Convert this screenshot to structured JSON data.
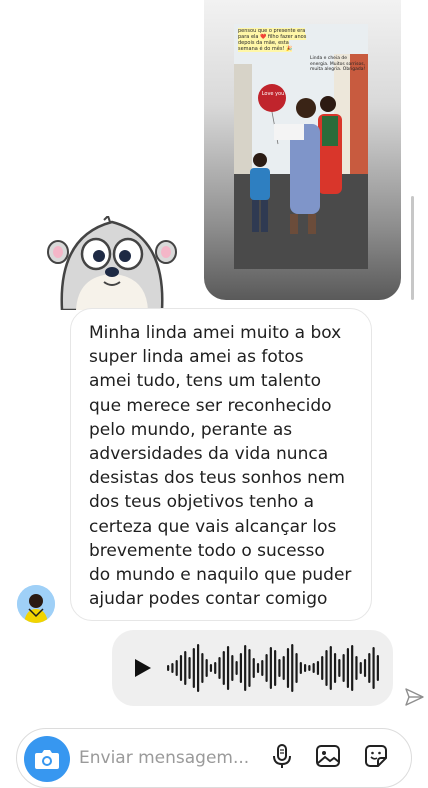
{
  "story": {
    "caption": "pensou que o presente era para ela ❤️ filho fazer anos depois da mãe, esta semana é do mês! 🎉",
    "note": "Linda e cheia de energia. Muitos sorrisos, muita alegria. Obrigada!",
    "balloon_text": "Love you"
  },
  "message": {
    "text": "Minha linda amei muito a box\nsuper linda amei as fotos\namei tudo, tens um talento\nque merece ser reconhecido\npelo mundo, perante as\nadversidades da vida nunca\ndesistas dos teus sonhos nem\ndos teus objetivos tenho a\ncerteza que vais alcançar los\nbrevemente todo o sucesso\ndo mundo e naquilo que puder\najudar podes contar comigo"
  },
  "voice_message": {
    "waveform": [
      6,
      10,
      16,
      26,
      34,
      22,
      40,
      48,
      30,
      18,
      8,
      12,
      22,
      34,
      44,
      26,
      14,
      30,
      46,
      38,
      20,
      10,
      16,
      28,
      42,
      36,
      18,
      24,
      40,
      48,
      30,
      12,
      8,
      6,
      10,
      14,
      24,
      36,
      44,
      30,
      18,
      28,
      40,
      46,
      24,
      12,
      18,
      30,
      42,
      26
    ]
  },
  "composer": {
    "placeholder": "Enviar mensagem..."
  },
  "colors": {
    "accent": "#3797f0",
    "bubble_border": "#e6e6e6",
    "voice_bg": "#efefef"
  },
  "icons": {
    "camera": "camera-icon",
    "mic": "microphone-icon",
    "gallery": "gallery-icon",
    "sticker": "sticker-icon",
    "send": "send-arrow-icon",
    "play": "play-icon"
  }
}
